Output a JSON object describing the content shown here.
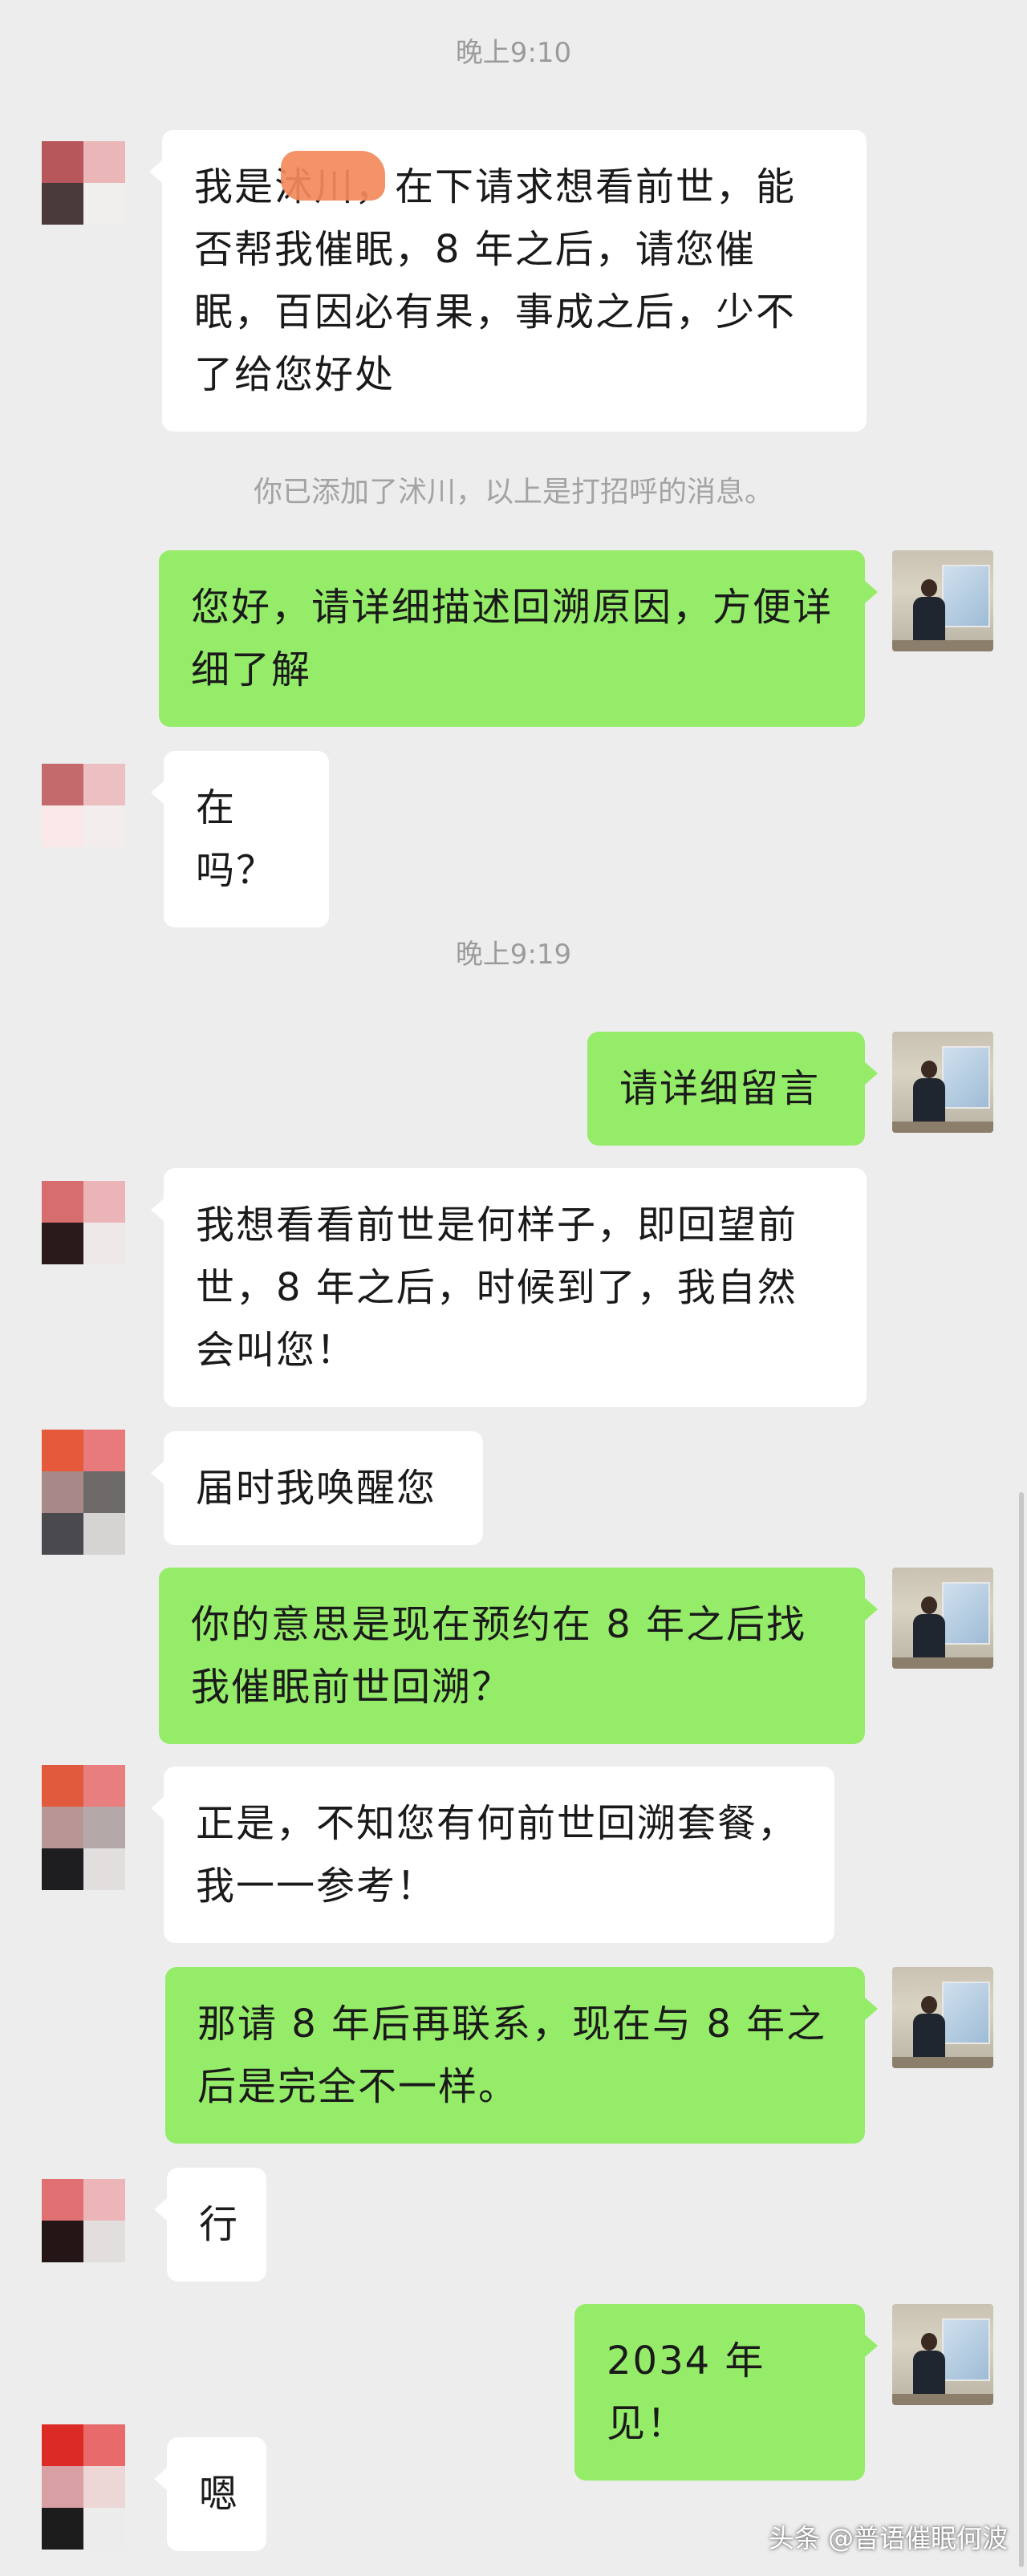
{
  "timestamps": [
    "晚上9:10",
    "晚上9:19"
  ],
  "system_notice": "你已添加了沭川，以上是打招呼的消息。",
  "messages": [
    {
      "sender": "contact",
      "text": "我是沭川，在下请求想看前世，能否帮我催眠，8 年之后，请您催眠，百因必有果，事成之后，少不了给您好处",
      "redacted": true
    },
    {
      "sender": "me",
      "text": "您好，请详细描述回溯原因，方便详细了解"
    },
    {
      "sender": "contact",
      "text": "在吗？"
    },
    {
      "sender": "me",
      "text": "请详细留言"
    },
    {
      "sender": "contact",
      "text": "我想看看前世是何样子，即回望前世，8 年之后，时候到了，我自然会叫您！"
    },
    {
      "sender": "contact",
      "text": "届时我唤醒您"
    },
    {
      "sender": "me",
      "text": "你的意思是现在预约在 8 年之后找我催眠前世回溯？"
    },
    {
      "sender": "contact",
      "text": "正是，不知您有何前世回溯套餐，我一一参考！"
    },
    {
      "sender": "me",
      "text": "那请 8 年后再联系，现在与 8 年之后是完全不一样。"
    },
    {
      "sender": "contact",
      "text": "行"
    },
    {
      "sender": "me",
      "text": "2034 年见！"
    },
    {
      "sender": "contact",
      "text": "嗯"
    }
  ],
  "watermark": "头条 @普语催眠何波",
  "colors": {
    "background": "#ededed",
    "incoming_bubble": "#ffffff",
    "outgoing_bubble": "#95ec69",
    "timestamp_text": "#9b9b9b"
  },
  "icons": {
    "contact_avatar": "pixelated-avatar-icon",
    "my_avatar": "presenter-photo-avatar-icon"
  }
}
